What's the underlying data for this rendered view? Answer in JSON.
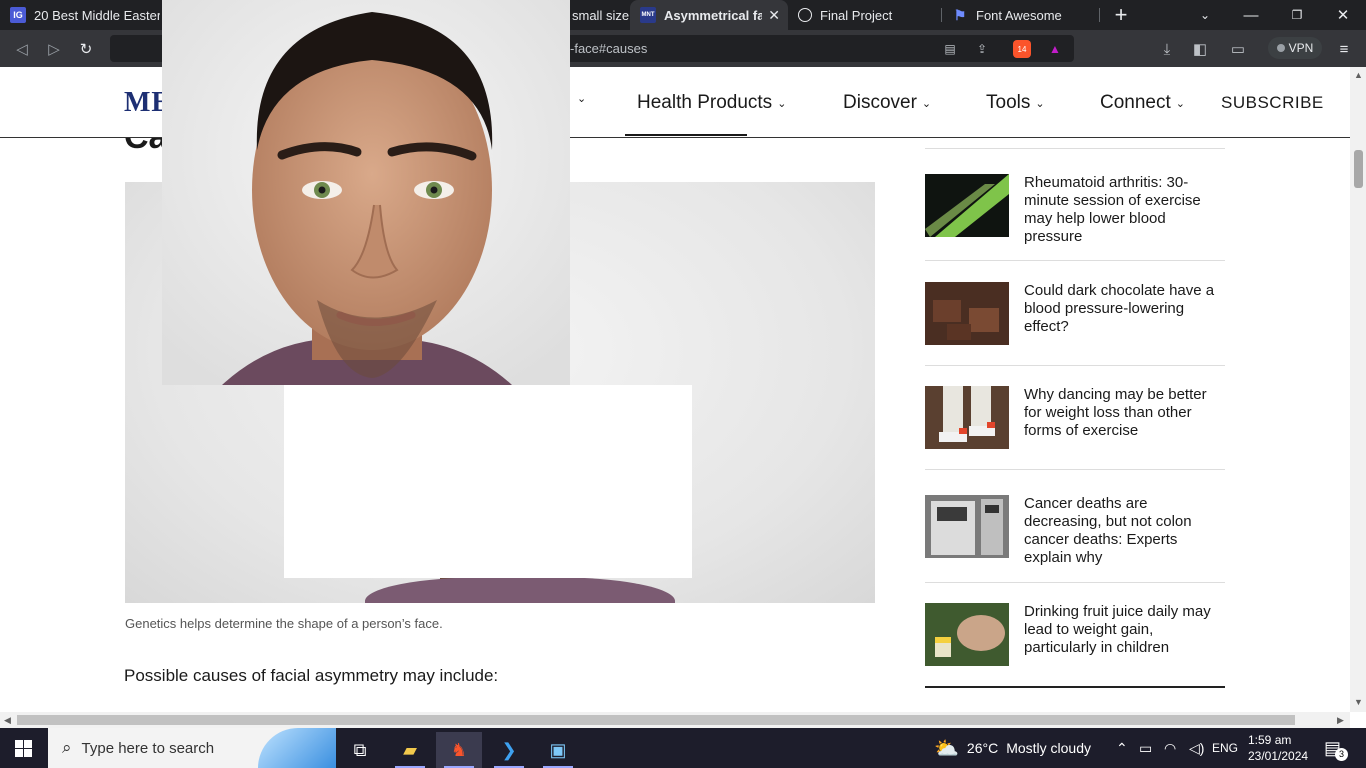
{
  "browser": {
    "tabs": [
      {
        "title": "20 Best Middle Eastern",
        "favicon": "IG"
      },
      {
        "title": "small size",
        "favicon": ""
      },
      {
        "title": "Asymmetrical fac",
        "favicon": "MNT"
      },
      {
        "title": "Final Project",
        "favicon": "globe"
      },
      {
        "title": "Font Awesome",
        "favicon": "flag"
      }
    ],
    "new_tab_label": "+",
    "url": "-face#causes",
    "shield_badge": "14",
    "vpn_label": "VPN"
  },
  "site": {
    "logo": "ME",
    "nav": [
      {
        "label": "Health Products"
      },
      {
        "label": "Discover"
      },
      {
        "label": "Tools"
      },
      {
        "label": "Connect"
      }
    ],
    "subscribe": "SUBSCRIBE"
  },
  "article": {
    "heading_fragment": "Ca",
    "caption": "Genetics helps determine the shape of a person’s face.",
    "paragraph": "Possible causes of facial asymmetry may include:"
  },
  "sidebar": {
    "items": [
      {
        "title": "Rheumatoid arthritis: 30-minute session of exercise may help lower blood pressure"
      },
      {
        "title": "Could dark chocolate have a blood pressure-lowering effect?"
      },
      {
        "title": "Why dancing may be better for weight loss than other forms of exercise"
      },
      {
        "title": "Cancer deaths are decreasing, but not colon cancer deaths: Experts explain why"
      },
      {
        "title": "Drinking fruit juice daily may lead to weight gain, particularly in children"
      }
    ]
  },
  "taskbar": {
    "search_placeholder": "Type here to search",
    "weather_temp": "26°C",
    "weather_desc": "Mostly cloudy",
    "language": "ENG",
    "time": "1:59 am",
    "date": "23/01/2024",
    "notification_count": "3"
  }
}
